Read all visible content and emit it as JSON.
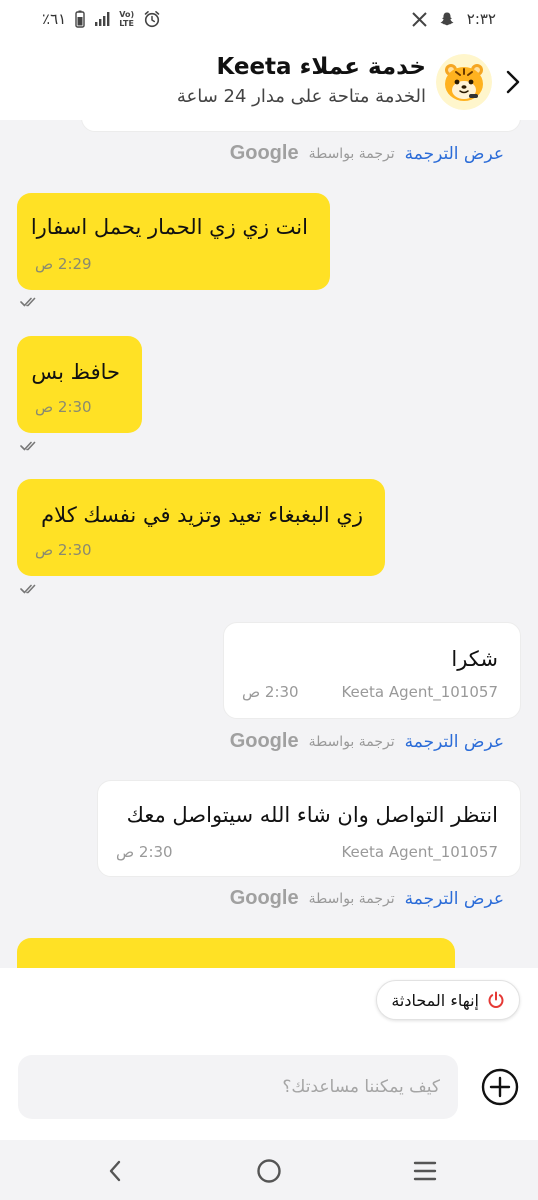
{
  "status_bar": {
    "time": "٢:٣٢",
    "battery": "٪٦١",
    "volte_label_top": "Vo)",
    "volte_label_bottom": "LTE"
  },
  "header": {
    "title": "خدمة عملاء Keeta",
    "subtitle": "الخدمة متاحة على مدار 24 ساعة"
  },
  "translation": {
    "show_label": "عرض الترجمة",
    "by_label": "ترجمة بواسطة",
    "brand": "Google"
  },
  "messages": [
    {
      "sender": "user",
      "text": "انت زي زي الحمار يحمل اسفارا",
      "time": "2:29 ص",
      "status": "read"
    },
    {
      "sender": "user",
      "text": "حافظ بس",
      "time": "2:30 ص",
      "status": "read"
    },
    {
      "sender": "user",
      "text": "زي البغبغاء تعيد وتزيد في نفسك كلام",
      "time": "2:30 ص",
      "status": "read"
    },
    {
      "sender": "agent",
      "text": "شكرا",
      "agent_name": "Keeta Agent_101057",
      "time": "2:30 ص"
    },
    {
      "sender": "agent",
      "text": "انتظر التواصل وان شاء الله سيتواصل معك",
      "agent_name": "Keeta Agent_101057",
      "time": "2:30 ص"
    }
  ],
  "end_chat": {
    "label": "إنهاء المحادثة",
    "icon": "power-icon",
    "icon_color": "#e53935"
  },
  "composer": {
    "placeholder": "كيف يمكننا مساعدتك؟",
    "add_icon": "plus-circle-icon"
  },
  "colors": {
    "user_bubble": "#ffe125",
    "agent_bubble": "#ffffff",
    "link": "#2b6cd8",
    "background": "#f3f3f5"
  }
}
